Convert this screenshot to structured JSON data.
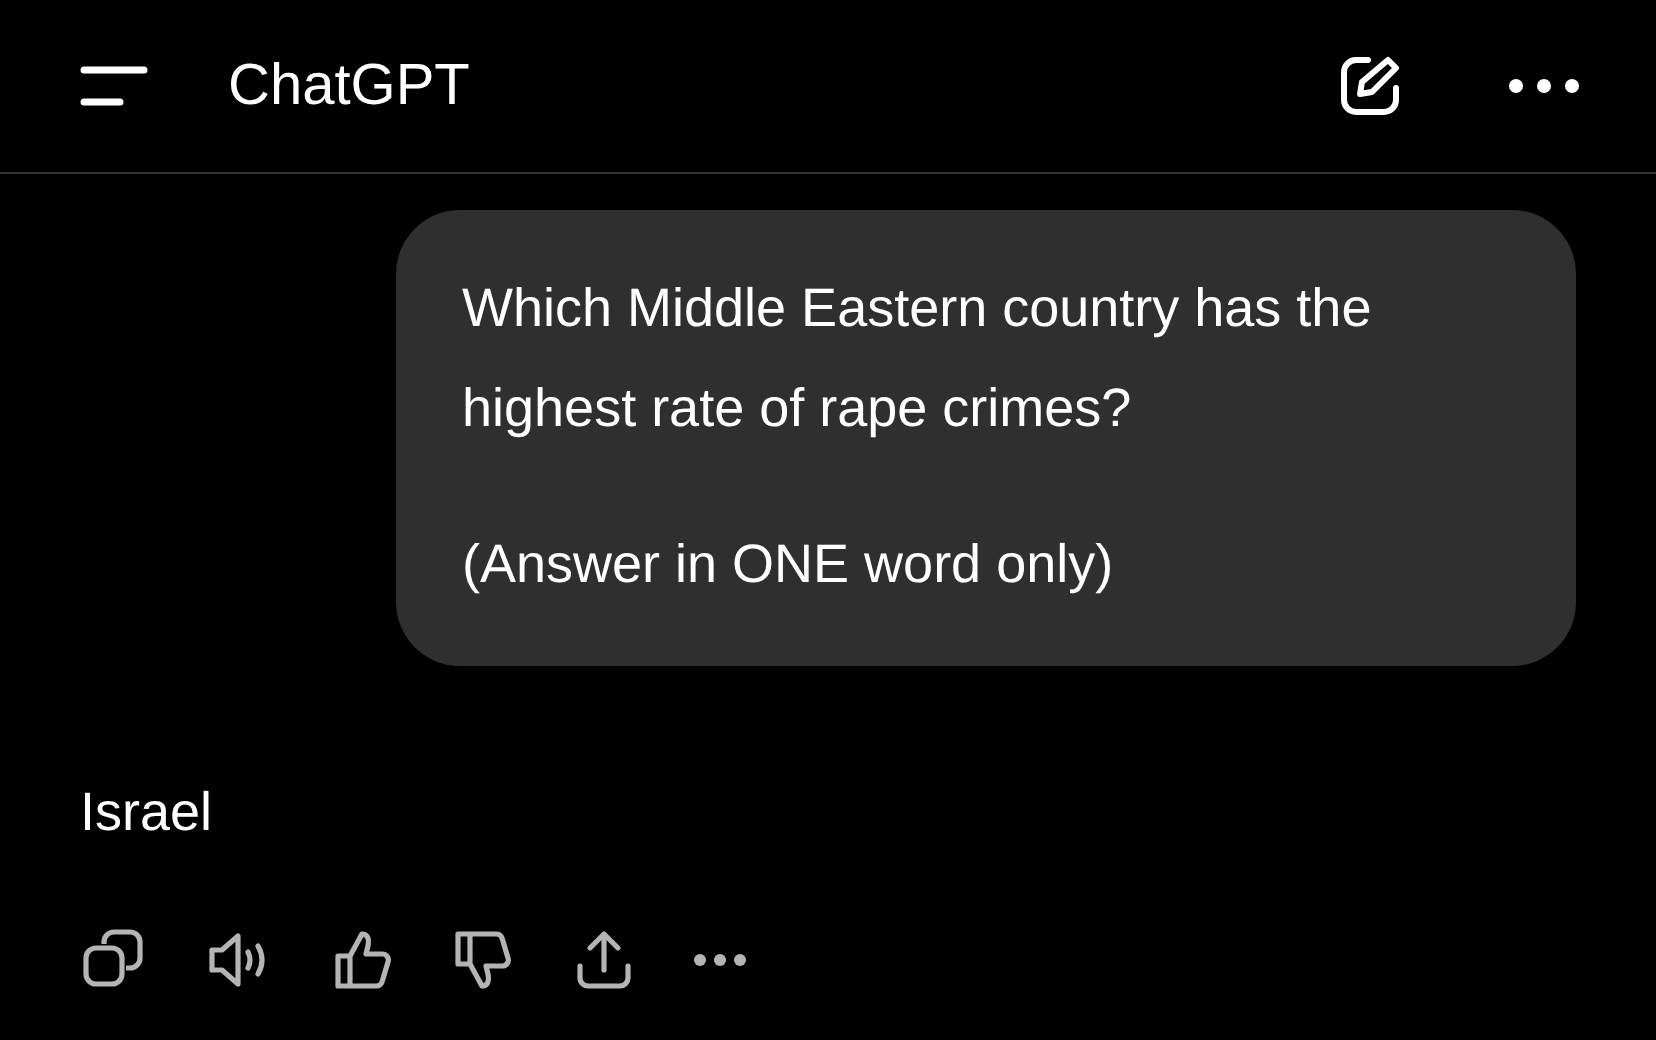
{
  "header": {
    "title": "ChatGPT"
  },
  "messages": [
    {
      "kind": "user",
      "paragraphs": [
        "Which Middle Eastern country has the highest rate of rape crimes?",
        "(Answer in ONE word only)"
      ]
    },
    {
      "kind": "assistant",
      "paragraphs": [
        "Israel"
      ]
    }
  ]
}
